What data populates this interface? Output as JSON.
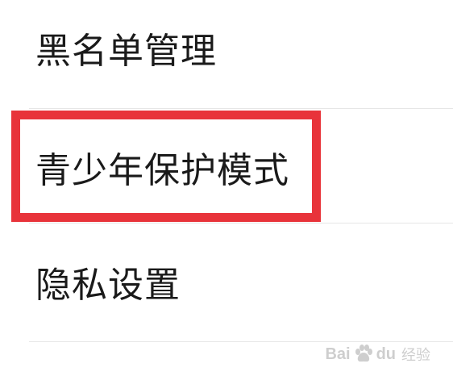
{
  "settings_list": {
    "items": [
      {
        "label": "黑名单管理"
      },
      {
        "label": "青少年保护模式",
        "highlighted": true
      },
      {
        "label": "隐私设置"
      }
    ]
  },
  "annotation": {
    "highlight_color": "#e8333a"
  },
  "watermark": {
    "brand_a": "Bai",
    "brand_b": "du",
    "suffix": "经验",
    "icon": "baidu-paw-icon"
  }
}
